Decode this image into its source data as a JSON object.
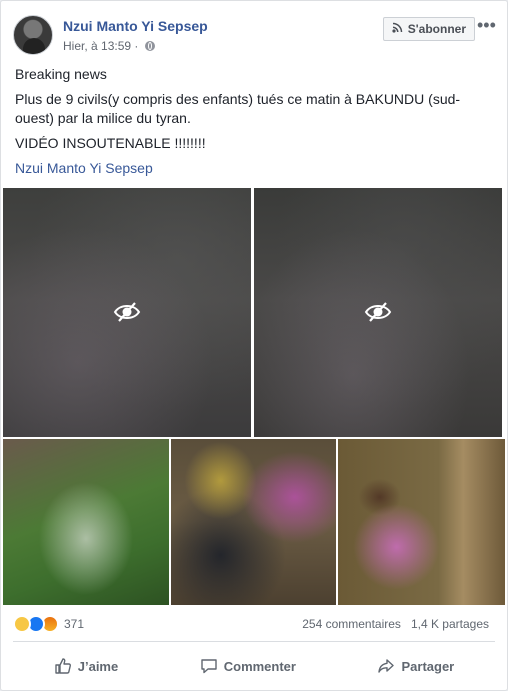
{
  "post": {
    "author": "Nzui Manto Yi Sepsep",
    "timestamp": "Hier, à 13:59 ·",
    "follow_label": "S'abonner",
    "more_glyph": "•••",
    "lines": [
      "Breaking news",
      "Plus de 9 civils(y compris des enfants) tués ce matin à BAKUNDU (sud-ouest) par la milice du tyran.",
      "VIDÉO INSOUTENABLE !!!!!!!!",
      "Nzui Manto Yi Sepsep"
    ]
  },
  "media": {
    "blurred_icon": "eye-slash-icon",
    "photo_count": 3
  },
  "stats": {
    "reactions": [
      "sad",
      "like",
      "angry"
    ],
    "reaction_count": "371",
    "comments": "254 commentaires",
    "shares": "1,4 K partages"
  },
  "actions": {
    "like": "J’aime",
    "comment": "Commenter",
    "share": "Partager"
  },
  "colors": {
    "link": "#385898",
    "like_blue": "#1877f2",
    "sad_yellow": "#f7c744",
    "angry_orange": "#e9710f"
  }
}
